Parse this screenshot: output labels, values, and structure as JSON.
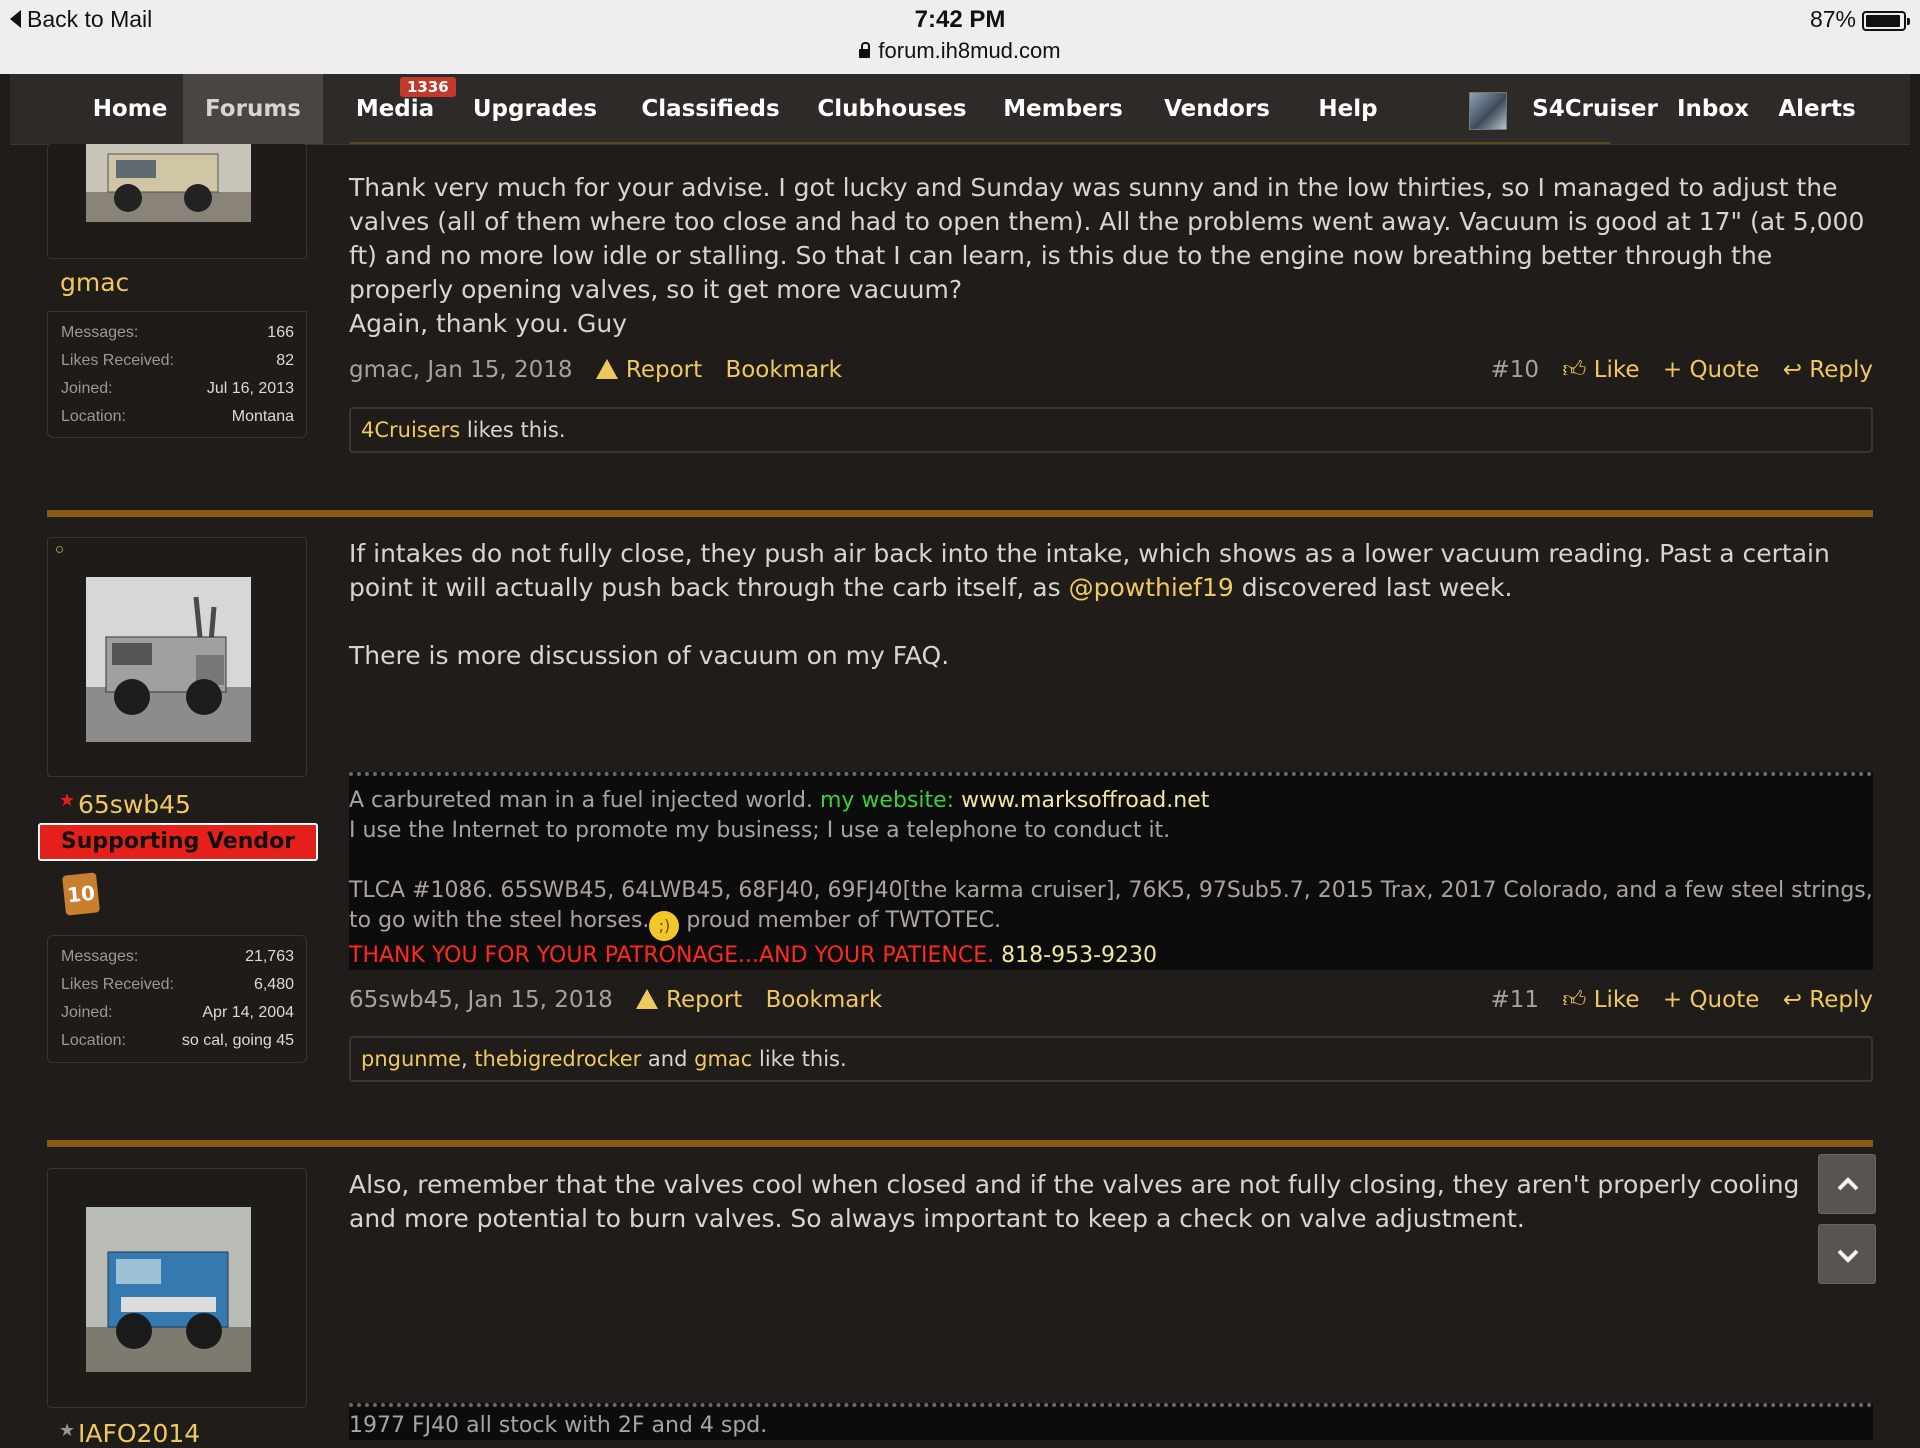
{
  "status_bar": {
    "back_label": "Back to Mail",
    "time": "7:42 PM",
    "url": "forum.ih8mud.com",
    "battery": "87%",
    "battery_level": 0.87
  },
  "nav": {
    "items": [
      "Home",
      "Forums",
      "Media",
      "Upgrades",
      "Classifieds",
      "Clubhouses",
      "Members",
      "Vendors",
      "Help"
    ],
    "active": "Forums",
    "media_badge": "1336",
    "user": "S4Cruiser",
    "inbox": "Inbox",
    "alerts": "Alerts"
  },
  "posts": [
    {
      "author": "gmac",
      "stats": [
        {
          "k": "Messages:",
          "v": "166"
        },
        {
          "k": "Likes Received:",
          "v": "82"
        },
        {
          "k": "Joined:",
          "v": "Jul 16, 2013"
        },
        {
          "k": "Location:",
          "v": "Montana"
        }
      ],
      "body": [
        "Thank very much for your advise. I got lucky and Sunday was sunny and in the low thirties, so I managed to adjust the valves (all of them where too close and had to open them). All the problems went away. Vacuum is good at 17\" (at 5,000 ft) and no more low idle or stalling. So that I can learn, is this due to the engine now breathing better through the properly opening valves, so it get more vacuum?",
        "Again, thank you. Guy"
      ],
      "meta": "gmac, Jan 15, 2018",
      "number": "#10",
      "likes_names": [
        "4Cruisers"
      ],
      "likes_suffix": " likes this."
    },
    {
      "author": "65swb45",
      "badge": "Supporting Vendor",
      "rank": "10",
      "stats": [
        {
          "k": "Messages:",
          "v": "21,763"
        },
        {
          "k": "Likes Received:",
          "v": "6,480"
        },
        {
          "k": "Joined:",
          "v": "Apr 14, 2004"
        },
        {
          "k": "Location:",
          "v": "so cal, going 45"
        }
      ],
      "body_1a": "If intakes do not fully close, they push air back into the intake, which shows as a lower vacuum reading. Past a certain point it will actually push back through the carb itself, as ",
      "mention": "@powthief19",
      "body_1b": " discovered last week.",
      "body_2": "There is more discussion of vacuum on my FAQ.",
      "signature": {
        "line1": "A carbureted man in a fuel injected world. ",
        "website_label": "my website:",
        "website": "www.marksoffroad.net",
        "line2": "I use the Internet to promote my business; I use a telephone to conduct it.",
        "line3a": "TLCA #1086. 65SWB45, 64LWB45, 68FJ40, 69FJ40[the karma cruiser], 76K5, 97Sub5.7, 2015 Trax, 2017 Colorado, and a few steel strings, to go with the steel horses.",
        "line3b": " proud member of TWTOTEC.",
        "thanks": "THANK YOU FOR YOUR PATRONAGE...AND YOUR PATIENCE.",
        "phone": "818-953-9230"
      },
      "meta": "65swb45, Jan 15, 2018",
      "number": "#11",
      "likes_a": "pngunme",
      "likes_b": "thebigredrocker",
      "likes_c": "gmac",
      "likes_and": " and ",
      "likes_suffix": " like this."
    },
    {
      "author": "IAFO2014",
      "body": "Also, remember that the valves cool when closed and if the valves are not fully closing, they aren't properly cooling and more potential to burn valves. So always important to keep a check on valve adjustment.",
      "signature": "1977 FJ40 all stock with 2F and 4 spd."
    }
  ],
  "actions": {
    "report": "Report",
    "bookmark": "Bookmark",
    "like": "Like",
    "quote": "+ Quote",
    "reply": "Reply"
  },
  "colors": {
    "accent": "#f0c95e",
    "background": "#201c1a",
    "divider": "#8a5a12",
    "vendor_badge": "#e5201a",
    "website_label": "#38d13a",
    "thanks": "#ff2a1a"
  }
}
